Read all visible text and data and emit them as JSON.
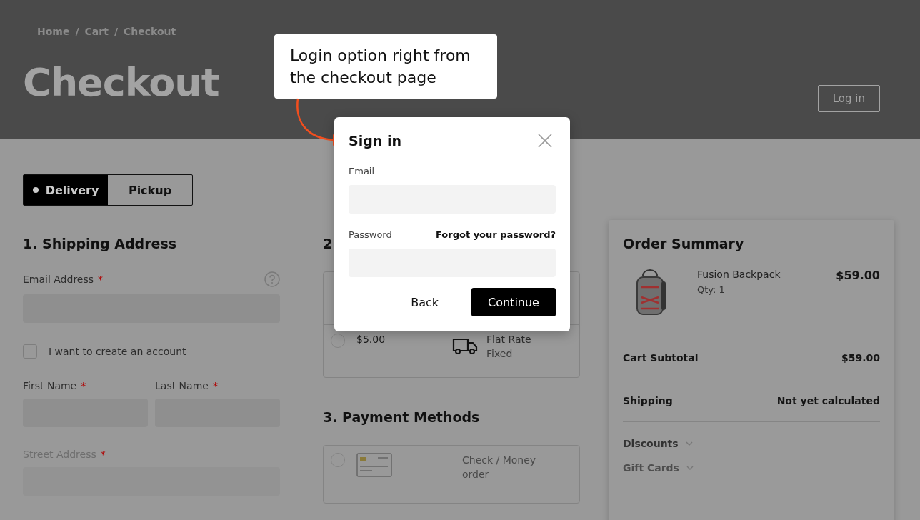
{
  "header": {
    "breadcrumbs": [
      "Home",
      "Cart",
      "Checkout"
    ],
    "separator": "/",
    "title": "Checkout",
    "login_button": "Log in"
  },
  "delivery_toggle": [
    {
      "label": "Delivery",
      "selected": true
    },
    {
      "label": "Pickup",
      "selected": false
    }
  ],
  "shipping_address": {
    "heading": "1. Shipping Address",
    "email": {
      "label": "Email Address",
      "required_mark": "*"
    },
    "create_account": {
      "label": "I want to create an account",
      "checked": false
    },
    "name_fields": [
      {
        "label": "First Name",
        "required_mark": "*"
      },
      {
        "label": "Last Name",
        "required_mark": "*"
      }
    ],
    "street": {
      "label": "Street Address",
      "required_mark": "*"
    }
  },
  "shipping_methods": {
    "heading": "2.",
    "rows": [
      {
        "price": "$5.00",
        "carrier": "Flat Rate",
        "method": "Fixed",
        "selected": false
      }
    ]
  },
  "payment_methods": {
    "heading": "3. Payment Methods",
    "rows": [
      {
        "label": "Check / Money order",
        "selected": false
      }
    ]
  },
  "order_summary": {
    "heading": "Order Summary",
    "item": {
      "name": "Fusion Backpack",
      "qty": "Qty: 1",
      "price": "$59.00"
    },
    "totals": [
      {
        "label": "Cart Subtotal",
        "value": "$59.00"
      },
      {
        "label": "Shipping",
        "value": "Not yet calculated"
      }
    ],
    "collapsibles": [
      {
        "label": "Discounts",
        "expanded": false
      },
      {
        "label": "Gift Cards",
        "expanded": false
      }
    ]
  },
  "callout": {
    "text": "Login option right from the checkout page"
  },
  "sign_in_modal": {
    "title": "Sign in",
    "fields": [
      {
        "label": "Email"
      },
      {
        "label": "Password",
        "link": "Forgot your password?"
      }
    ],
    "buttons": [
      {
        "label": "Back",
        "kind": "plain"
      },
      {
        "label": "Continue",
        "kind": "primary"
      }
    ]
  }
}
